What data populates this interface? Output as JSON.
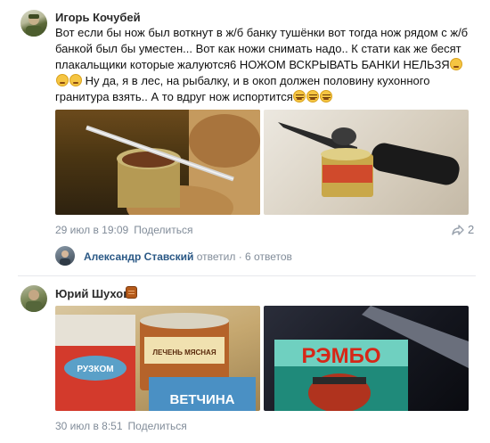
{
  "comments": [
    {
      "author": "Игорь Кочубей",
      "text_part1": "Вот если бы нож был воткнут в ж/б банку тушёнки вот тогда нож рядом с ж/б банкой был бы уместен... Вот как ножи снимать надо.. К стати как же бесят плакальщики которые жалуются6 НОЖОМ ВСКРЫВАТЬ БАНКИ НЕЛЬЗЯ",
      "text_part2": " Ну да, я в лес, на рыбалку, и в окоп должен половину кухонного гранитура взять.. А то вдруг нож испортится",
      "date": "29 июл в 19:09",
      "reply_label": "Поделиться",
      "share_count": "2",
      "replies_preview": {
        "name": "Александр Ставский",
        "action": "ответил",
        "count_text": "6 ответов"
      }
    },
    {
      "author": "Юрий Шухов",
      "date": "30 июл в 8:51",
      "reply_label": "Поделиться",
      "photo2_text": "РЭМБО",
      "photo1_brand": "РУЗКОМ",
      "photo1_label": "ВЕТЧИНА",
      "photo1_small": "ЛЕЧЕНЬ МЯСНАЯ"
    }
  ],
  "icons": {
    "share": "share-icon",
    "badge": "barrel-badge-icon",
    "emoji": "weary-face-emoji, rofl-emoji"
  }
}
